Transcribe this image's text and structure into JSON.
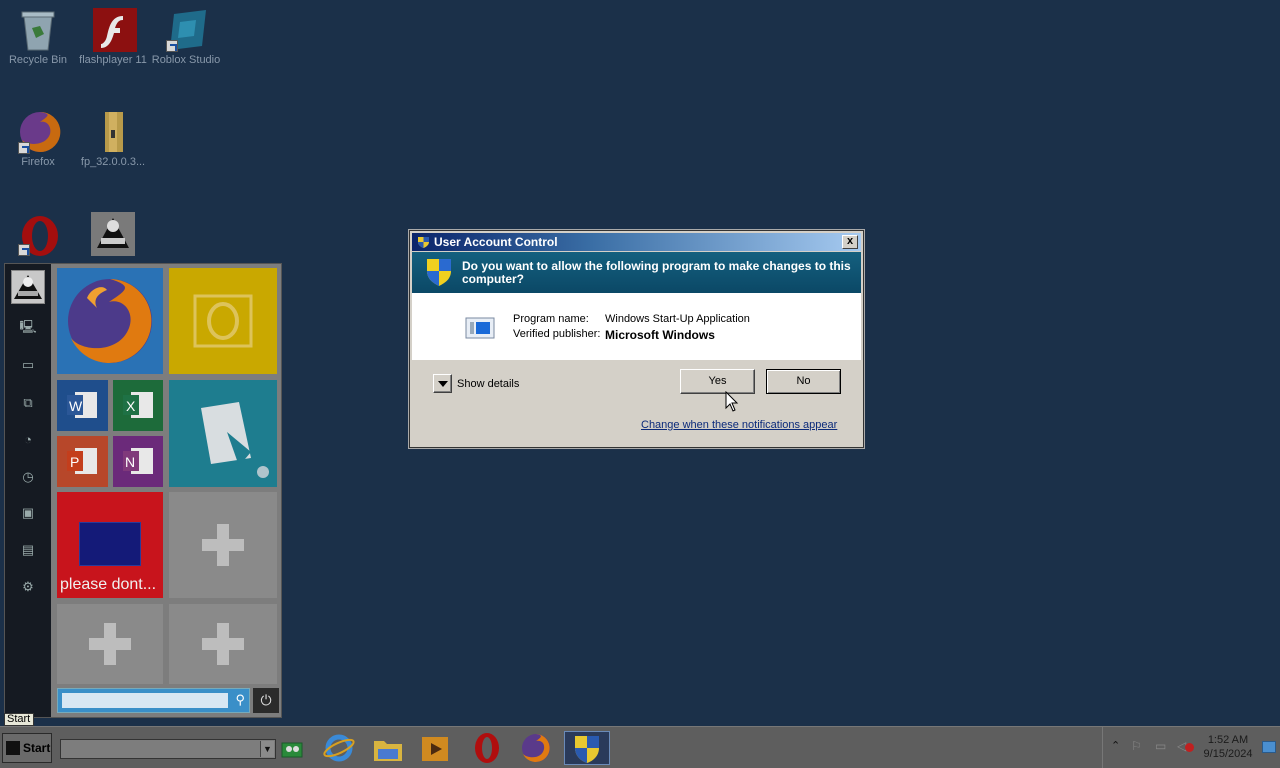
{
  "desktop": {
    "icons": [
      {
        "label": "Recycle Bin",
        "icon": "recycle-bin-icon"
      },
      {
        "label": "flashplayer 11",
        "icon": "flash-player-icon"
      },
      {
        "label": "Roblox Studio",
        "icon": "roblox-studio-icon"
      },
      {
        "label": "Firefox",
        "icon": "firefox-icon"
      },
      {
        "label": "fp_32.0.0.3...",
        "icon": "folder-icon"
      },
      {
        "label": "",
        "icon": "opera-icon"
      },
      {
        "label": "",
        "icon": "app-icon"
      }
    ]
  },
  "start_menu": {
    "tooltip": "Start",
    "rail_icons": [
      "user-avatar",
      "computer-icon",
      "drive-icon",
      "network-icon",
      "users-icon",
      "recent-icon",
      "display-icon",
      "monitor-icon",
      "settings-icon"
    ],
    "tiles": [
      {
        "name": "firefox-tile",
        "color": "#2a72b5"
      },
      {
        "name": "outlook-tile",
        "color": "#c9a800"
      },
      {
        "name": "word-tile",
        "color": "#1f4e8c"
      },
      {
        "name": "excel-tile",
        "color": "#1d6b3a"
      },
      {
        "name": "roblox-tile",
        "color": "#1e7d8f"
      },
      {
        "name": "powerpoint-tile",
        "color": "#b7472a"
      },
      {
        "name": "onenote-tile",
        "color": "#6b2a7a"
      },
      {
        "name": "custom-tile",
        "label": "please dont...",
        "color": "#c8141c"
      }
    ],
    "search_placeholder": ""
  },
  "dialog": {
    "title": "User Account Control",
    "question": "Do you want to allow the following program to make changes to this computer?",
    "program_name_label": "Program name:",
    "program_name_value": "Windows Start-Up Application",
    "publisher_label": "Verified publisher:",
    "publisher_value": "Microsoft Windows",
    "show_details": "Show details",
    "yes": "Yes",
    "no": "No",
    "change_link": "Change when these notifications appear",
    "close_glyph": "x"
  },
  "taskbar": {
    "start_label": "Start",
    "pinned": [
      "contacts-icon",
      "internet-explorer-icon",
      "file-explorer-icon",
      "media-player-icon",
      "opera-icon",
      "firefox-icon",
      "uac-shield-icon"
    ],
    "clock_time": "1:52 AM",
    "clock_date": "9/15/2024"
  },
  "colors": {
    "desktop_bg": "#1b3049",
    "taskbar_bg": "#5e5e5e",
    "dialog_bg": "#d4d0c8",
    "dialog_header_bg": "#0b4866"
  }
}
